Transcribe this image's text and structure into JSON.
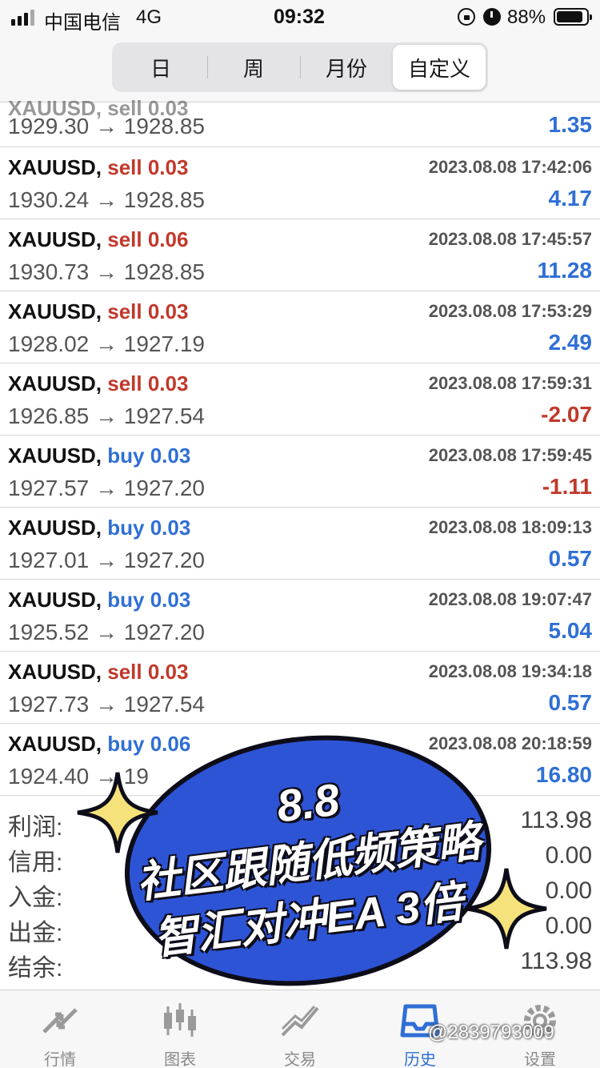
{
  "status_bar": {
    "carrier": "中国电信",
    "network": "4G",
    "time": "09:32",
    "battery_percent": "88%",
    "battery_level": 0.88,
    "icons": [
      "signal-icon",
      "orientation-lock-icon",
      "alarm-icon",
      "battery-icon"
    ]
  },
  "period_tabs": [
    {
      "label": "日"
    },
    {
      "label": "周"
    },
    {
      "label": "月份"
    },
    {
      "label": "自定义",
      "active": true
    }
  ],
  "partial_row": {
    "symbol_fragment": "XAUUSD, sell 0.03",
    "prices": "1929.30 → 1928.85",
    "profit": "1.35"
  },
  "trades": [
    {
      "symbol": "XAUUSD,",
      "side": "sell 0.03",
      "time": "2023.08.08 17:42:06",
      "prices": "1930.24 → 1928.85",
      "profit": "4.17"
    },
    {
      "symbol": "XAUUSD,",
      "side": "sell 0.06",
      "time": "2023.08.08 17:45:57",
      "prices": "1930.73 → 1928.85",
      "profit": "11.28"
    },
    {
      "symbol": "XAUUSD,",
      "side": "sell 0.03",
      "time": "2023.08.08 17:53:29",
      "prices": "1928.02 → 1927.19",
      "profit": "2.49"
    },
    {
      "symbol": "XAUUSD,",
      "side": "sell 0.03",
      "time": "2023.08.08 17:59:31",
      "prices": "1926.85 → 1927.54",
      "profit": "-2.07"
    },
    {
      "symbol": "XAUUSD,",
      "side": "buy 0.03",
      "time": "2023.08.08 17:59:45",
      "prices": "1927.57 → 1927.20",
      "profit": "-1.11"
    },
    {
      "symbol": "XAUUSD,",
      "side": "buy 0.03",
      "time": "2023.08.08 18:09:13",
      "prices": "1927.01 → 1927.20",
      "profit": "0.57"
    },
    {
      "symbol": "XAUUSD,",
      "side": "buy 0.03",
      "time": "2023.08.08 19:07:47",
      "prices": "1925.52 → 1927.20",
      "profit": "5.04"
    },
    {
      "symbol": "XAUUSD,",
      "side": "sell 0.03",
      "time": "2023.08.08 19:34:18",
      "prices": "1927.73 → 1927.54",
      "profit": "0.57"
    },
    {
      "symbol": "XAUUSD,",
      "side": "buy 0.06",
      "time": "2023.08.08 20:18:59",
      "prices": "1924.40 → 19",
      "profit": "16.80"
    }
  ],
  "summary": [
    {
      "label": "利润:",
      "value": "113.98"
    },
    {
      "label": "信用:",
      "value": "0.00"
    },
    {
      "label": "入金:",
      "value": "0.00"
    },
    {
      "label": "出金:",
      "value": "0.00"
    },
    {
      "label": "结余:",
      "value": "113.98"
    }
  ],
  "overlay": {
    "line1": "8.8",
    "line2": "社区跟随低频策略",
    "line3": "智汇对冲EA 3倍"
  },
  "tab_bar": [
    {
      "label": "行情",
      "icon": "quotes-icon"
    },
    {
      "label": "图表",
      "icon": "chart-icon"
    },
    {
      "label": "交易",
      "icon": "trade-icon"
    },
    {
      "label": "历史",
      "icon": "history-icon",
      "active": true
    },
    {
      "label": "设置",
      "icon": "settings-icon"
    }
  ],
  "watermark": "@2839793009",
  "colors": {
    "sell": "#c0392b",
    "buy": "#2f6fd6",
    "profit_positive": "#2f6fd6",
    "profit_negative": "#c0392b",
    "overlay_blue": "#2e54d6",
    "sparkle": "#f6e27a"
  }
}
